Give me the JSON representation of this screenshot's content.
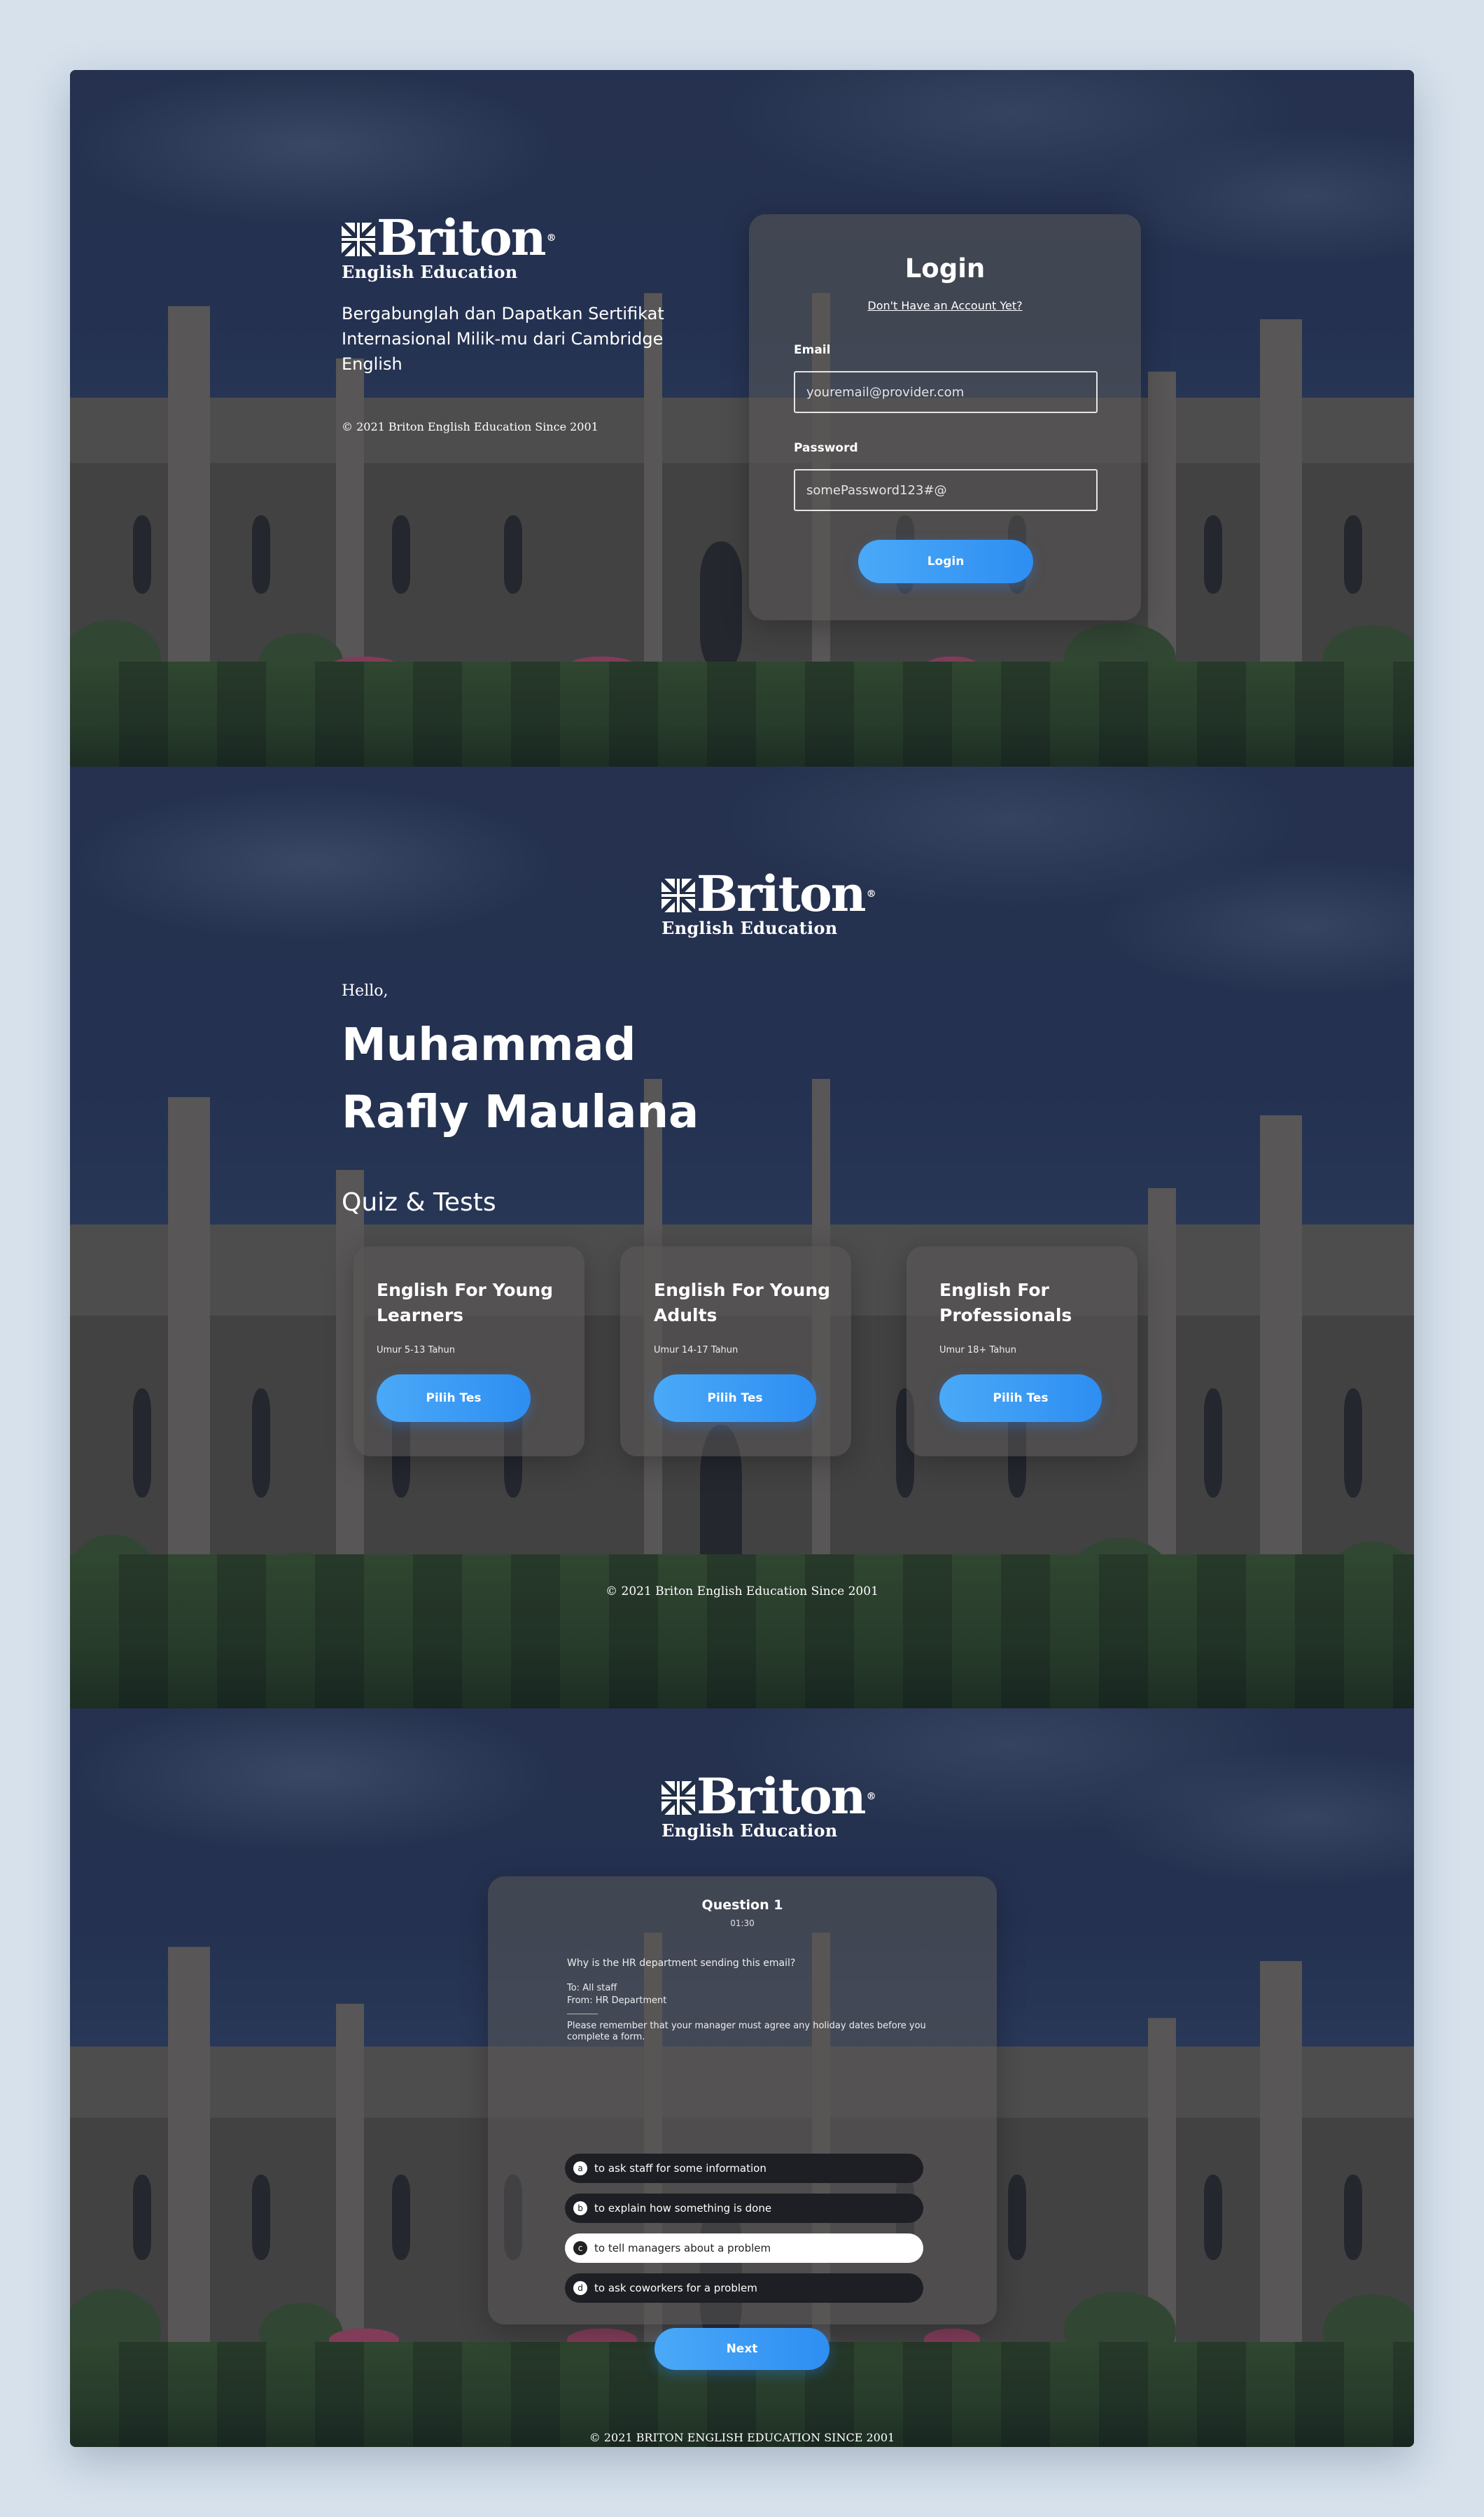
{
  "brand": {
    "name": "Briton",
    "registered": "®",
    "subtitle": "English Education"
  },
  "login_screen": {
    "tagline": "Bergabunglah dan Dapatkan Sertifikat Internasional Milik-mu dari Cambridge English",
    "copyright": "© 2021 Briton English Education Since 2001",
    "form": {
      "title": "Login",
      "signup_link": "Don't Have an Account Yet?",
      "email_label": "Email",
      "email_placeholder": "youremail@provider.com",
      "password_label": "Password",
      "password_value": "somePassword123#@",
      "submit_label": "Login"
    }
  },
  "home_screen": {
    "greeting": "Hello,",
    "user_first": "Muhammad",
    "user_last": "Rafly Maulana",
    "section_title": "Quiz & Tests",
    "cards": [
      {
        "title": "English For Young Learners",
        "age": "Umur 5-13 Tahun",
        "button": "Pilih Tes"
      },
      {
        "title": "English For Young Adults",
        "age": "Umur 14-17 Tahun",
        "button": "Pilih Tes"
      },
      {
        "title": "English For Professionals",
        "age": "Umur 18+ Tahun",
        "button": "Pilih Tes"
      }
    ],
    "copyright": "© 2021 Briton English Education Since 2001"
  },
  "quiz_screen": {
    "question_title": "Question 1",
    "timer": "01:30",
    "question": "Why is the HR department sending this email?",
    "email_to": "To: All staff",
    "email_from": "From: HR Department",
    "email_body": "Please remember that your manager must agree any holiday dates before you complete a form.",
    "options": [
      {
        "key": "a",
        "text": "to ask staff for some information"
      },
      {
        "key": "b",
        "text": "to explain how something is done"
      },
      {
        "key": "c",
        "text": "to tell managers about a problem"
      },
      {
        "key": "d",
        "text": "to ask coworkers for a problem"
      }
    ],
    "selected_option": "c",
    "next_label": "Next",
    "copyright": "© 2021 BRITON ENGLISH EDUCATION SINCE 2001"
  },
  "colors": {
    "accent": "#3a9cf5",
    "page_bg": "#d6e1ec",
    "overlay": "#1f2d45"
  }
}
